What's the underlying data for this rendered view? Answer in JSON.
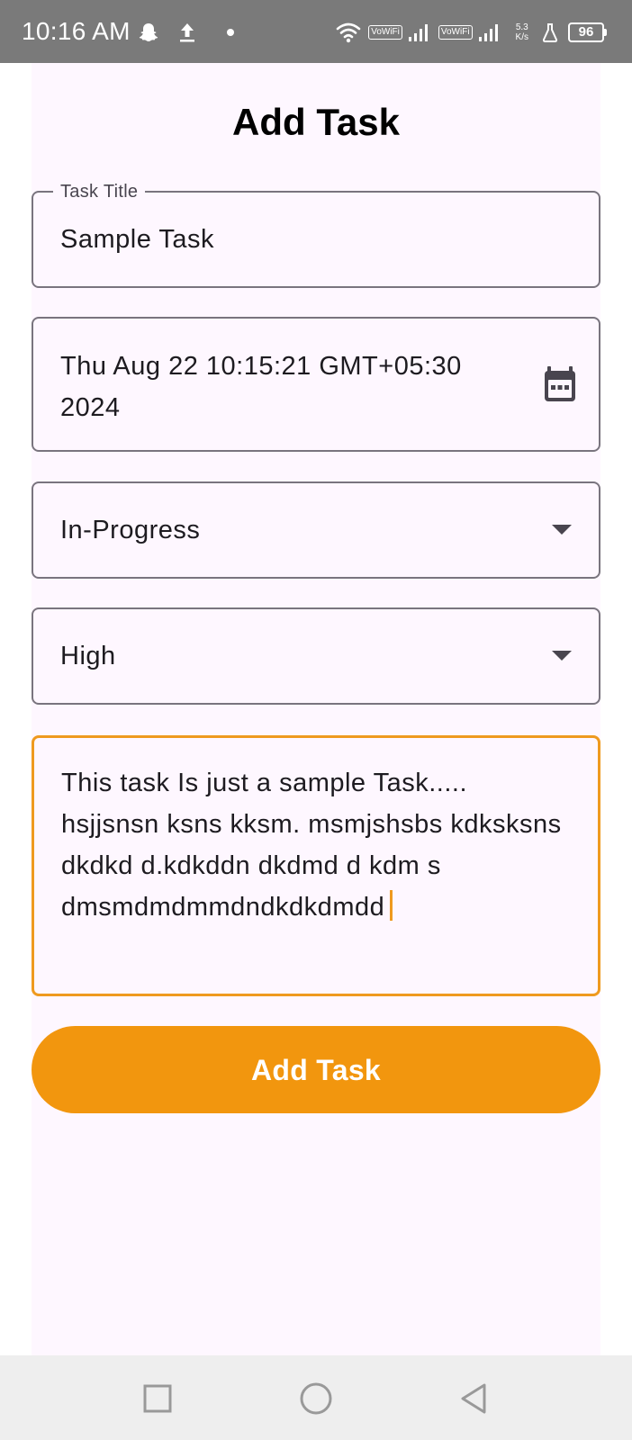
{
  "status_bar": {
    "time": "10:16 AM",
    "vowifi_1": "VoWiFi",
    "vowifi_2": "VoWiFi",
    "speed_value": "5.3",
    "speed_unit": "K/s",
    "battery": "96"
  },
  "page": {
    "title": "Add Task"
  },
  "form": {
    "task_title": {
      "label": "Task Title",
      "value": "Sample Task"
    },
    "due_date": {
      "value": "Thu Aug 22 10:15:21 GMT+05:30 2024"
    },
    "status": {
      "selected": "In-Progress"
    },
    "priority": {
      "selected": "High"
    },
    "description": {
      "value": "This task Is just a sample Task..... hsjjsnsn ksns kksm. msmjshsbs kdksksns dkdkd d.kdkddn dkdmd d kdm s dmsmdmdmmdndkdkdmdd"
    },
    "submit_label": "Add Task"
  },
  "colors": {
    "accent": "#f2960e",
    "focus_border": "#ef9a1f",
    "outline": "#79747e",
    "surface": "#fef7ff",
    "status_bar": "#7a7a7a",
    "nav_bar": "#eeeeee"
  },
  "icons": {
    "calendar": "calendar-icon",
    "dropdown": "dropdown-arrow-icon",
    "recents": "square-icon",
    "home": "circle-icon",
    "back": "triangle-back-icon"
  }
}
